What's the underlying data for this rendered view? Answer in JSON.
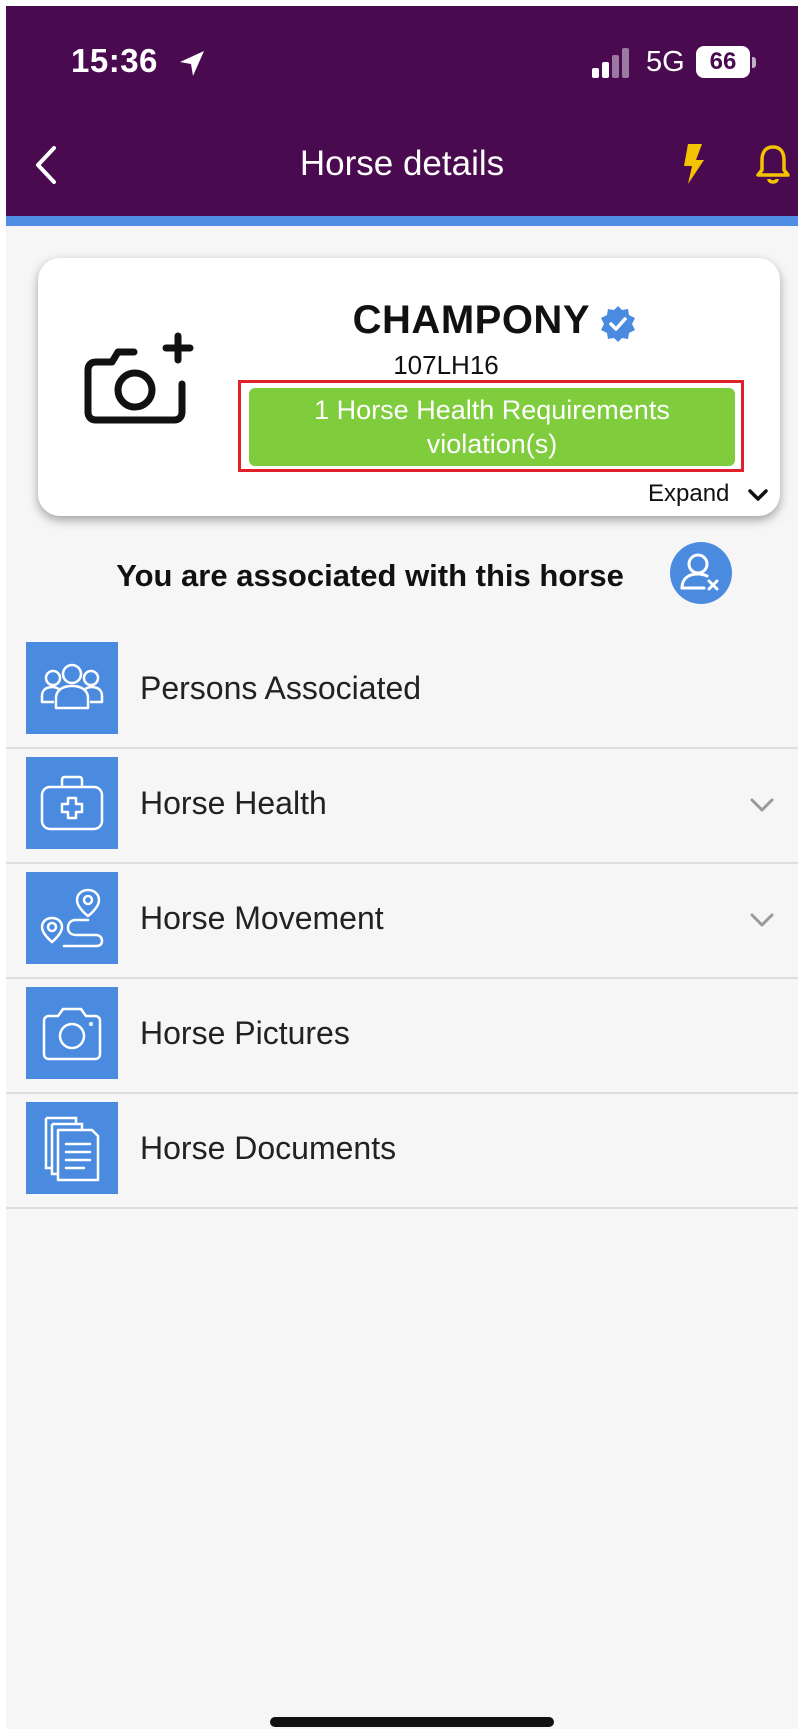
{
  "status_bar": {
    "time": "15:36",
    "network": "5G",
    "battery": "66"
  },
  "header": {
    "title": "Horse details"
  },
  "horse_card": {
    "name": "CHAMPONY",
    "id": "107LH16",
    "violation_text": "1 Horse Health Requirements violation(s)",
    "expand_label": "Expand"
  },
  "association": {
    "text": "You are associated with this horse"
  },
  "menu": {
    "items": [
      {
        "label": "Persons Associated",
        "icon": "people-icon",
        "expandable": false
      },
      {
        "label": "Horse Health",
        "icon": "medical-kit-icon",
        "expandable": true
      },
      {
        "label": "Horse Movement",
        "icon": "route-icon",
        "expandable": true
      },
      {
        "label": "Horse Pictures",
        "icon": "camera-icon",
        "expandable": false
      },
      {
        "label": "Horse Documents",
        "icon": "documents-icon",
        "expandable": false
      }
    ]
  },
  "colors": {
    "header_bg": "#4a0a50",
    "accent_blue": "#4a8be0",
    "violation_green": "#7fcc3c",
    "highlight_red": "#e0202a",
    "icon_yellow": "#f5c400"
  }
}
